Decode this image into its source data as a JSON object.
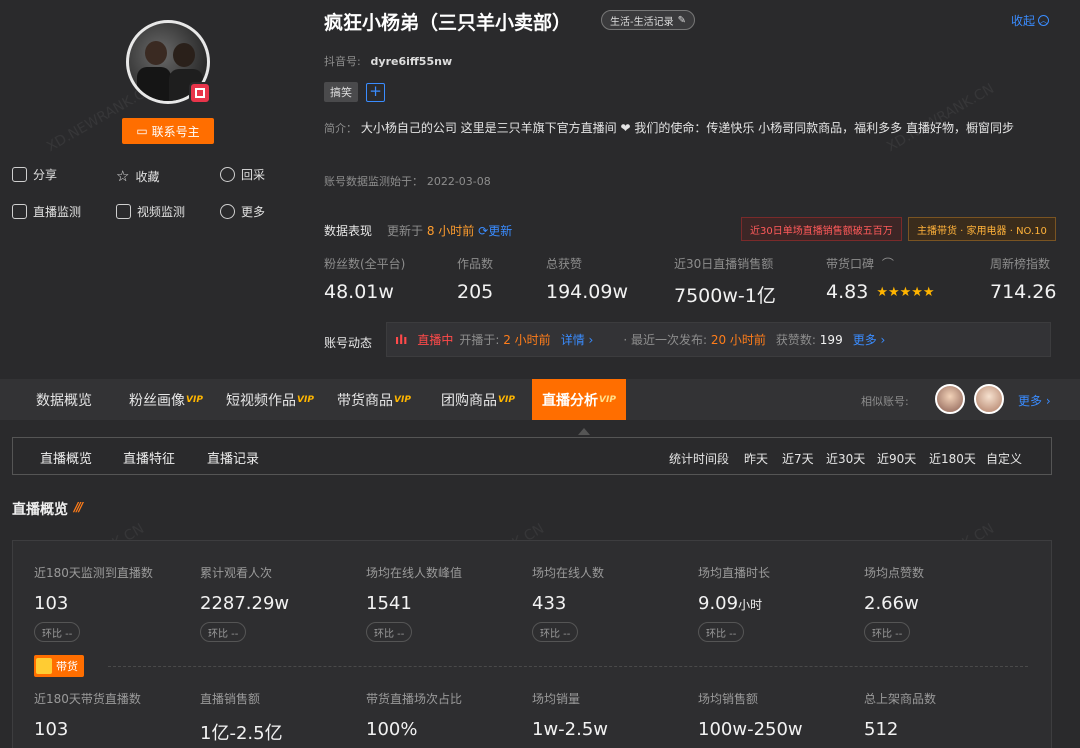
{
  "profile": {
    "name": "疯狂小杨弟（三只羊小卖部）",
    "category": "生活-生活记录",
    "collapse_label": "收起",
    "douyin_id_label": "抖音号:",
    "douyin_id": "dyre6iff55nw",
    "tag": "搞笑",
    "bio_label": "简介：",
    "bio": "大小杨自己的公司 这里是三只羊旗下官方直播间 ❤ 我们的使命：传递快乐 小杨哥同款商品，福利多多 直播好物，橱窗同步",
    "monitor_since_label": "账号数据监测始于：",
    "monitor_since": "2022-03-08",
    "contact_label": "联系号主"
  },
  "actions": {
    "share": "分享",
    "favorite": "收藏",
    "backfill": "回采",
    "live_monitor": "直播监测",
    "video_monitor": "视频监测",
    "more": "更多"
  },
  "performance": {
    "label": "数据表现",
    "updated_prefix": "更新于",
    "updated_time": "8 小时前",
    "refresh": "更新",
    "badge_red": "近30日单场直播销售额破五百万",
    "badge_orange": "主播带货 · 家用电器 · NO.10"
  },
  "stats": [
    {
      "label": "粉丝数(全平台)",
      "value": "48.01w"
    },
    {
      "label": "作品数",
      "value": "205"
    },
    {
      "label": "总获赞",
      "value": "194.09w"
    },
    {
      "label": "近30日直播销售额",
      "value": "7500w-1亿"
    },
    {
      "label": "带货口碑",
      "value": "4.83",
      "stars": "★★★★★"
    },
    {
      "label": "周新榜指数",
      "value": "714.26"
    }
  ],
  "dynamics": {
    "label": "账号动态",
    "live_status": "直播中",
    "start_label": "开播于:",
    "start_time": "2 小时前",
    "detail": "详情 ›",
    "last_post_label": "· 最近一次发布:",
    "last_post_time": "20 小时前",
    "likes_label": "获赞数:",
    "likes": "199",
    "more": "更多 ›"
  },
  "tabs": [
    {
      "label": "数据概览",
      "vip": ""
    },
    {
      "label": "粉丝画像",
      "vip": "VIP"
    },
    {
      "label": "短视频作品",
      "vip": "VIP"
    },
    {
      "label": "带货商品",
      "vip": "VIP"
    },
    {
      "label": "团购商品",
      "vip": "VIP"
    },
    {
      "label": "直播分析",
      "vip": "VIP"
    }
  ],
  "similar": {
    "label": "相似账号:",
    "more": "更多 ›"
  },
  "subnav": {
    "items": [
      "直播概览",
      "直播特征",
      "直播记录"
    ],
    "range_label": "统计时间段",
    "ranges": [
      "昨天",
      "近7天",
      "近30天",
      "近90天",
      "近180天",
      "自定义"
    ]
  },
  "overview": {
    "title": "直播概览",
    "row1": [
      {
        "label": "近180天监测到直播数",
        "value": "103",
        "unit": ""
      },
      {
        "label": "累计观看人次",
        "value": "2287.29w",
        "unit": ""
      },
      {
        "label": "场均在线人数峰值",
        "value": "1541",
        "unit": ""
      },
      {
        "label": "场均在线人数",
        "value": "433",
        "unit": ""
      },
      {
        "label": "场均直播时长",
        "value": "9.09",
        "unit": "小时"
      },
      {
        "label": "场均点赞数",
        "value": "2.66w",
        "unit": ""
      }
    ],
    "hb": "环比 --",
    "cart_label": "带货",
    "row2": [
      {
        "label": "近180天带货直播数",
        "value": "103"
      },
      {
        "label": "直播销售额",
        "value": "1亿-2.5亿"
      },
      {
        "label": "带货直播场次占比",
        "value": "100%"
      },
      {
        "label": "场均销量",
        "value": "1w-2.5w"
      },
      {
        "label": "场均销售额",
        "value": "100w-250w"
      },
      {
        "label": "总上架商品数",
        "value": "512"
      }
    ]
  },
  "watermark": "XD.NEWRANK.CN"
}
